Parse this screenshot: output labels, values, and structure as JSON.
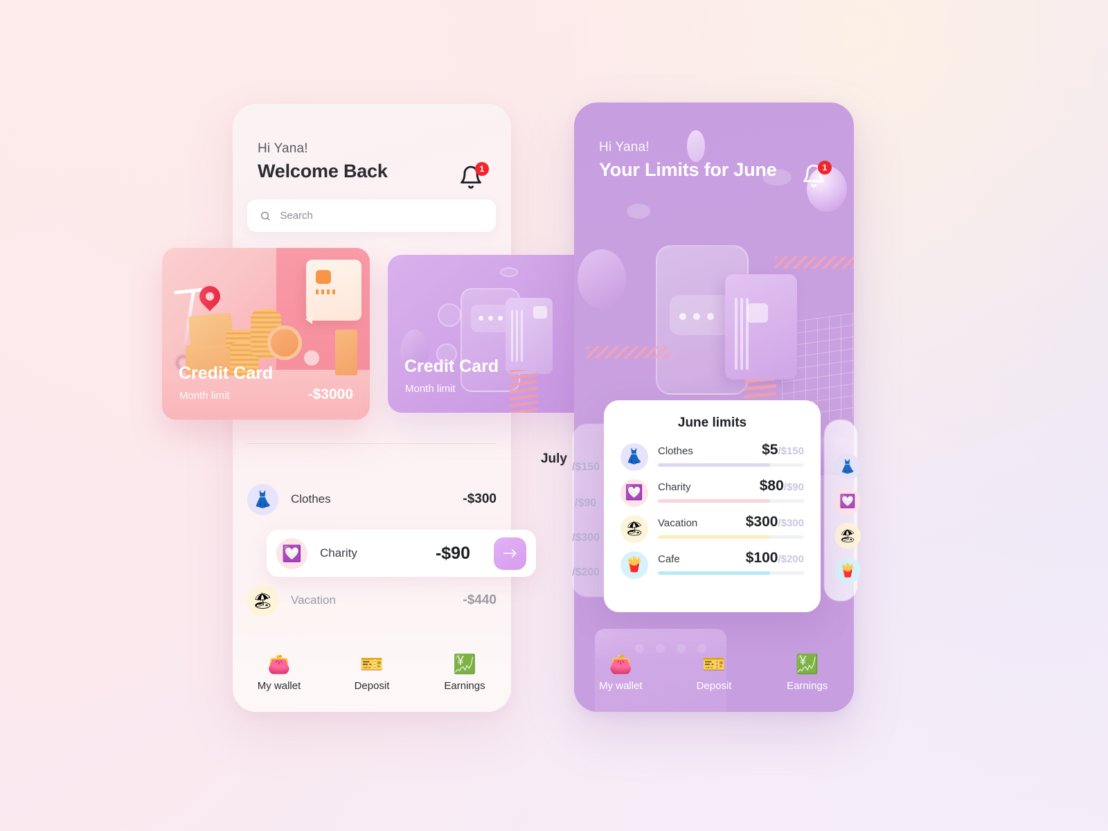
{
  "left_phone": {
    "greeting": "Hi Yana!",
    "title": "Welcome Back",
    "notification_count": "1",
    "search": {
      "placeholder": "Search",
      "value": "",
      "icon": "search-icon"
    },
    "cards": [
      {
        "title": "Credit Card",
        "subtitle": "Month limit",
        "amount": "-$3000",
        "theme": "#f79aa6"
      },
      {
        "title": "Credit Card",
        "subtitle": "Month limit",
        "amount": "",
        "theme": "#cb9ce4"
      }
    ],
    "month": "July",
    "transactions": [
      {
        "icon": "dress-icon",
        "glyph": "👗",
        "name": "Clothes",
        "amount": "-$300",
        "highlighted": false
      },
      {
        "icon": "heart-message-icon",
        "glyph": "💟",
        "name": "Charity",
        "amount": "-$90",
        "highlighted": true,
        "action": "→"
      },
      {
        "icon": "beach-umbrella-icon",
        "glyph": "🏖",
        "name": "Vacation",
        "amount": "-$440",
        "highlighted": false
      }
    ],
    "nav": [
      {
        "icon": "wallet-icon",
        "glyph": "👛",
        "label": "My wallet"
      },
      {
        "icon": "coupon-icon",
        "glyph": "🎫",
        "label": "Deposit"
      },
      {
        "icon": "chart-increasing-icon",
        "glyph": "💹",
        "label": "Earnings"
      }
    ]
  },
  "right_phone": {
    "greeting": "Hi Yana!",
    "title": "Your Limits for June",
    "notification_count": "1",
    "panel": {
      "title": "June limits",
      "rows": [
        {
          "icon": "dress-icon",
          "glyph": "👗",
          "name": "Clothes",
          "spent": "$5",
          "limit": "/$150",
          "percent": 77,
          "color": "#ddd6f7",
          "bg": "#e7e3fb"
        },
        {
          "icon": "heart-message-icon",
          "glyph": "💟",
          "name": "Charity",
          "spent": "$80",
          "limit": "/$90",
          "percent": 77,
          "color": "#fbd3dc",
          "bg": "#fde4e8"
        },
        {
          "icon": "beach-umbrella-icon",
          "glyph": "🏖",
          "name": "Vacation",
          "spent": "$300",
          "limit": "/$300",
          "percent": 77,
          "color": "#fbeeb8",
          "bg": "#fdf4d9"
        },
        {
          "icon": "fries-icon",
          "glyph": "🍟",
          "name": "Cafe",
          "spent": "$100",
          "limit": "/$200",
          "percent": 77,
          "color": "#b7e9f7",
          "bg": "#d7f2fb"
        }
      ]
    },
    "behind_panel_limits": [
      "/$150",
      "/$90",
      "/$300",
      "/$200"
    ],
    "nav": [
      {
        "icon": "wallet-icon",
        "glyph": "👛",
        "label": "My wallet"
      },
      {
        "icon": "coupon-icon",
        "glyph": "🎫",
        "label": "Deposit"
      },
      {
        "icon": "chart-increasing-icon",
        "glyph": "💹",
        "label": "Earnings"
      }
    ]
  }
}
